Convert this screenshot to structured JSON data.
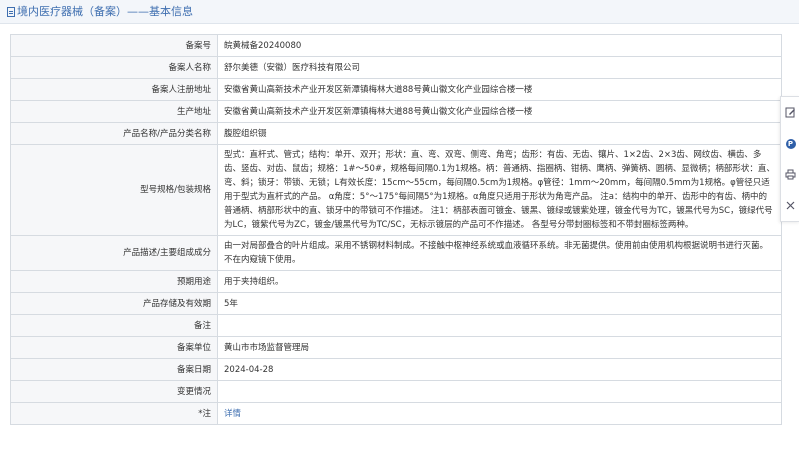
{
  "header": {
    "title": "境内医疗器械（备案）——基本信息",
    "icon": "document-icon"
  },
  "rows": [
    {
      "label": "备案号",
      "value": "皖黄械备20240080"
    },
    {
      "label": "备案人名称",
      "value": "舒尔美德（安徽）医疗科技有限公司"
    },
    {
      "label": "备案人注册地址",
      "value": "安徽省黄山高新技术产业开发区新潭镇梅林大道88号黄山徽文化产业园综合楼一楼"
    },
    {
      "label": "生产地址",
      "value": "安徽省黄山高新技术产业开发区新潭镇梅林大道88号黄山徽文化产业园综合楼一楼"
    },
    {
      "label": "产品名称/产品分类名称",
      "value": "腹腔组织镊"
    },
    {
      "label": "型号规格/包装规格",
      "value": "型式：直杆式、管式；结构：单开、双开；形状：直、弯、双弯、侧弯、角弯；齿形：有齿、无齿、镶片、1×2齿、2×3齿、网纹齿、横齿、多齿、竖齿、对齿、鼠齿；规格：1#～50#，规格每间隔0.1为1规格。柄：普通柄、指圈柄、钳柄、鹰柄、弹簧柄、圆柄、显微柄；柄部形状：直、弯、斜；锁牙：带锁、无锁；L有效长度：15cm～55cm，每间隔0.5cm为1规格。φ管径：1mm～20mm，每间隔0.5mm为1规格。φ管径只适用于型式为直杆式的产品。 α角度：5°～175°每间隔5°为1规格。α角度只适用于形状为角弯产品。 注a：结构中的单开、齿形中的有齿、柄中的普通柄、柄部形状中的直、锁牙中的带锁可不作描述。 注1：柄部表面可镀金、镀黑、镀绿或镀紫处理，镀金代号为TC，镀黑代号为SC，镀绿代号为LC，镀紫代号为ZC，镀金/镀黑代号为TC/SC，无标示镀层的产品可不作描述。 各型号分带封圈标签和不带封圈标签两种。"
    },
    {
      "label": "产品描述/主要组成成分",
      "value": "由一对局部叠合的叶片组成。采用不锈钢材料制成。不接触中枢神经系统或血液循环系统。非无菌提供。使用前由使用机构根据说明书进行灭菌。不在内窥镜下使用。"
    },
    {
      "label": "预期用途",
      "value": "用于夹持组织。"
    },
    {
      "label": "产品存储及有效期",
      "value": "5年"
    },
    {
      "label": "备注",
      "value": ""
    },
    {
      "label": "备案单位",
      "value": "黄山市市场监督管理局"
    },
    {
      "label": "备案日期",
      "value": "2024-04-28"
    },
    {
      "label": "变更情况",
      "value": ""
    },
    {
      "label": "*注",
      "value": "详情"
    }
  ],
  "sidebar": {
    "icons": [
      "edit-icon",
      "p-icon",
      "print-icon",
      "close-icon"
    ],
    "p_label": "P"
  }
}
